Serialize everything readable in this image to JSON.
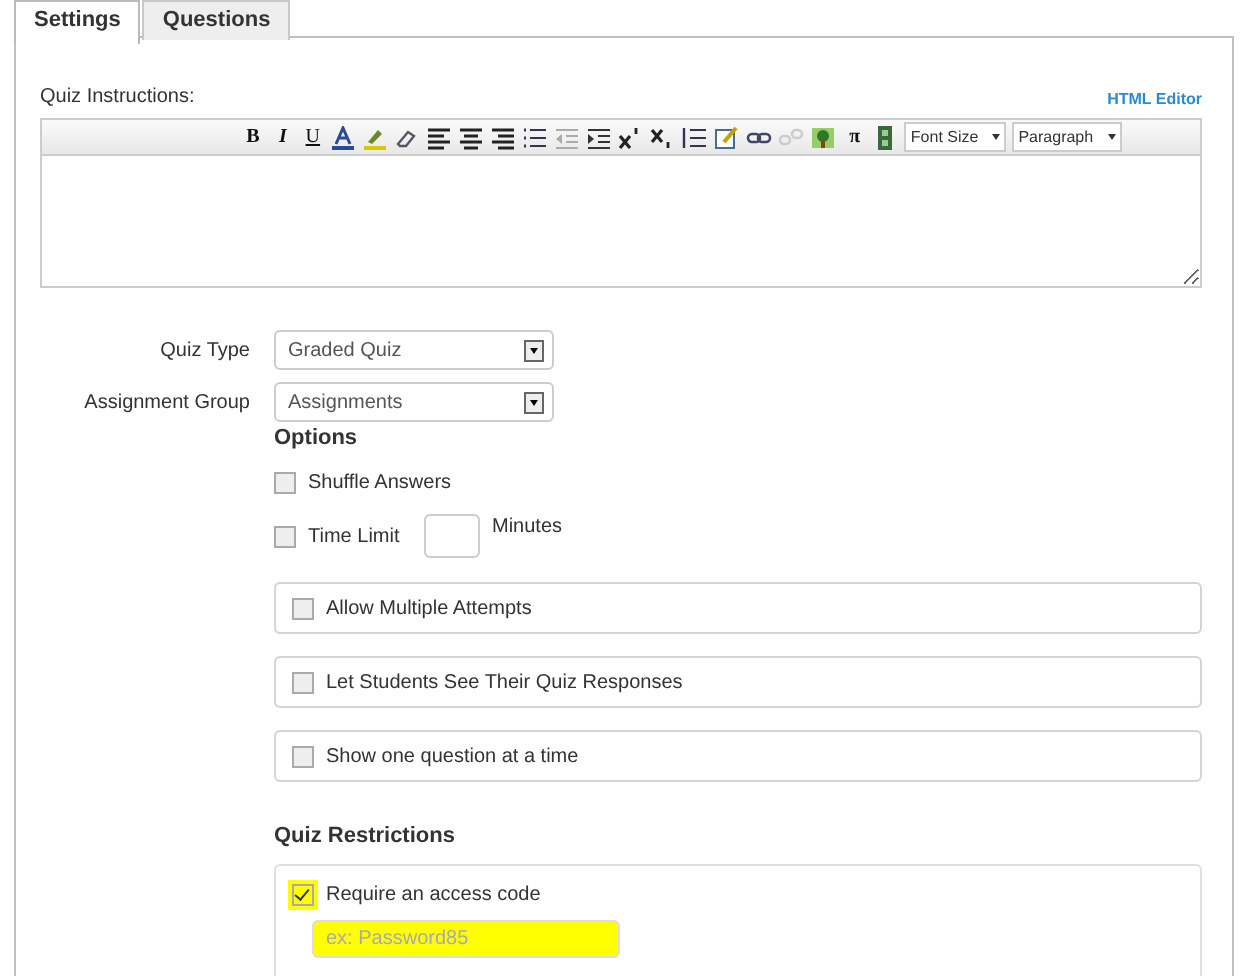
{
  "tabs": [
    {
      "label": "Settings",
      "selected": true
    },
    {
      "label": "Questions",
      "selected": false
    }
  ],
  "instructions": {
    "label": "Quiz Instructions:",
    "html_editor_link": "HTML Editor",
    "toolbar": {
      "format_buttons": [
        "B",
        "I",
        "U"
      ],
      "symbol": "π",
      "dropdowns": [
        "Font Size",
        "Paragraph"
      ]
    }
  },
  "fields": [
    {
      "label": "Quiz Type",
      "value": "Graded Quiz"
    },
    {
      "label": "Assignment Group",
      "value": "Assignments"
    }
  ],
  "options": {
    "title": "Options",
    "items": [
      {
        "kind": "plain",
        "label": "Shuffle Answers",
        "checked": false
      },
      {
        "kind": "timed",
        "label": "Time Limit",
        "checked": false,
        "unit": "Minutes"
      },
      {
        "kind": "boxed",
        "label": "Allow Multiple Attempts",
        "checked": false
      },
      {
        "kind": "boxed",
        "label": "Let Students See Their Quiz Responses",
        "checked": false
      },
      {
        "kind": "boxed",
        "label": "Show one question at a time",
        "checked": false
      }
    ]
  },
  "restrictions": {
    "title": "Quiz Restrictions",
    "label": "Require an access code",
    "checked": true,
    "placeholder": "ex: Password85"
  }
}
